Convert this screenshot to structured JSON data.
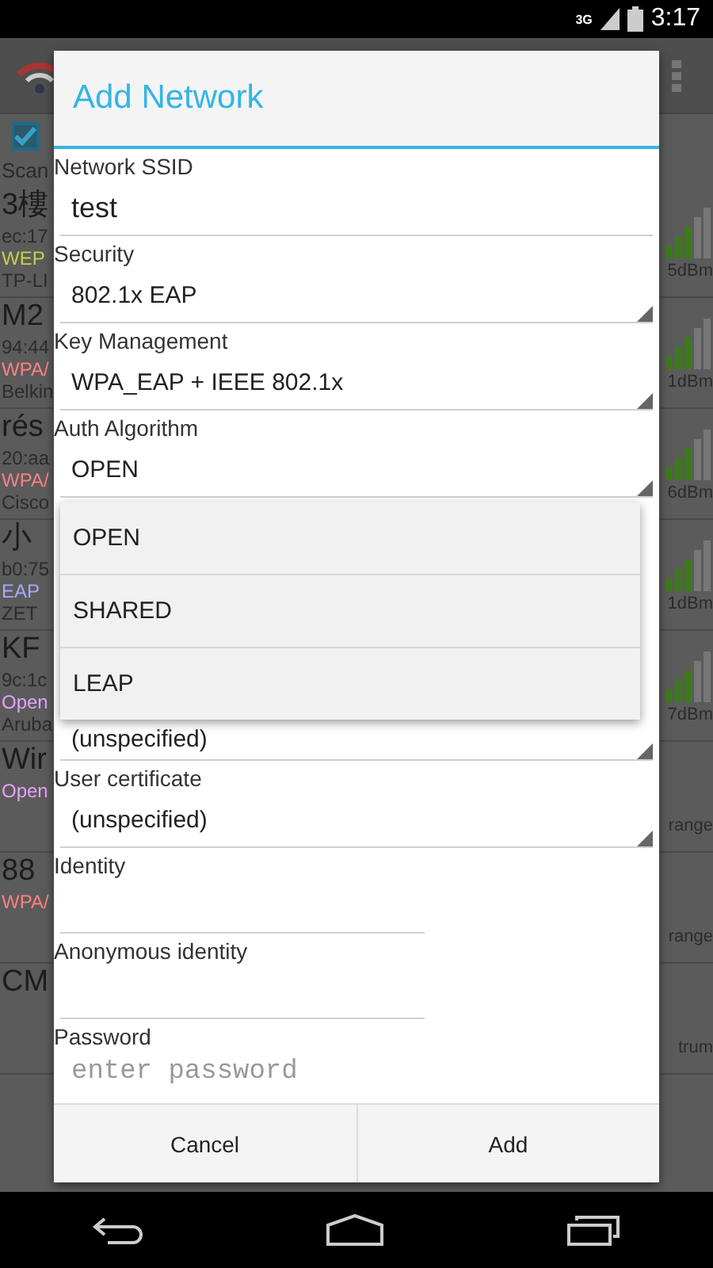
{
  "status_bar": {
    "network": "3G",
    "time": "3:17"
  },
  "background": {
    "filter_checked": true,
    "scan_label": "Scan",
    "networks": [
      {
        "kind": "signal",
        "name": "3樓",
        "bssid": "ec:17",
        "security": "WEP",
        "color": "#c8d048",
        "vendor": "TP-LI",
        "reading": "5dBm"
      },
      {
        "kind": "signal",
        "name": "M2",
        "bssid": "94:44",
        "security": "WPA/",
        "color": "#ff8080",
        "vendor": "Belkin",
        "reading": "1dBm"
      },
      {
        "kind": "signal",
        "name": "rés",
        "bssid": "20:aa",
        "security": "WPA/",
        "color": "#ff8080",
        "vendor": "Cisco",
        "reading": "6dBm"
      },
      {
        "kind": "signal",
        "name": "小",
        "bssid": "b0:75",
        "security": "EAP",
        "color": "#a8a8ff",
        "vendor": "ZET",
        "reading": "1dBm"
      },
      {
        "kind": "signal",
        "name": "KF",
        "bssid": "9c:1c",
        "security": "Open",
        "color": "#e8a0ff",
        "vendor": "Aruba",
        "reading": "7dBm"
      },
      {
        "kind": "plain",
        "name": "Wir",
        "security": "Open",
        "color": "#e8a0ff",
        "reading": "range"
      },
      {
        "kind": "plain",
        "name": "88",
        "security": "WPA/",
        "color": "#ff8080",
        "reading": "range"
      },
      {
        "kind": "plain",
        "name": "CM",
        "reading": "trum"
      }
    ]
  },
  "dialog": {
    "title": "Add Network",
    "fields": [
      {
        "kind": "text",
        "label": "Network SSID",
        "value": "test"
      },
      {
        "kind": "spinner",
        "label": "Security",
        "value": "802.1x EAP"
      },
      {
        "kind": "spinner",
        "label": "Key Management",
        "value": "WPA_EAP + IEEE 802.1x"
      },
      {
        "kind": "spinner",
        "label": "Auth Algorithm",
        "value": "OPEN"
      },
      {
        "kind": "menu",
        "options": [
          "OPEN",
          "SHARED",
          "LEAP"
        ]
      },
      {
        "kind": "spinner",
        "value": "(unspecified)"
      },
      {
        "kind": "spinner",
        "label": "User certificate",
        "value": "(unspecified)"
      },
      {
        "kind": "text",
        "label": "Identity"
      },
      {
        "kind": "text",
        "label": "Anonymous identity"
      },
      {
        "kind": "password",
        "label": "Password",
        "placeholder": "enter password"
      }
    ],
    "buttons": [
      "Cancel",
      "Add"
    ]
  }
}
